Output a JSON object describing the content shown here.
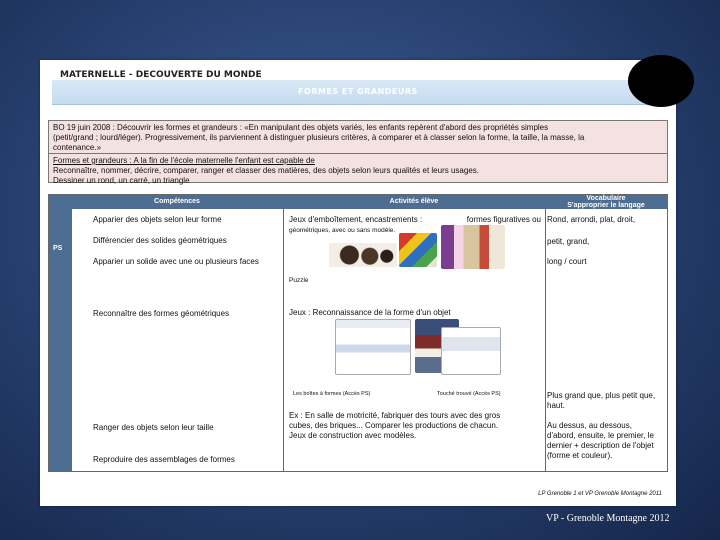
{
  "header": {
    "title": "MATERNELLE - DECOUVERTE DU MONDE",
    "subtitle": "FORMES ET GRANDEURS"
  },
  "box1": {
    "line1": "BO 19 juin 2008 : Découvrir les formes et grandeurs : «En manipulant des objets variés, les enfants repèrent d'abord des propriétés simples",
    "line2": "(petit/grand ; lourd/léger). Progressivement, ils parviennent à distinguer plusieurs critères, à comparer et à classer selon la forme, la taille, la masse, la",
    "line3": "contenance.»"
  },
  "box2": {
    "line1": "Formes et grandeurs : A la fin de l'école maternelle l'enfant est capable de",
    "line2": "Reconnaître, nommer, décrire, comparer, ranger et classer des matières, des objets selon leurs qualités et leurs usages.",
    "line3": "Dessiner un rond, un carré, un triangle"
  },
  "table": {
    "headers": {
      "competences": "Compétences",
      "activites": "Activités élève",
      "vocabulaire_line1": "Vocabulaire",
      "vocabulaire_line2": "S'approprier le langage"
    },
    "row_label": "PS",
    "competences": [
      "Apparier des objets selon leur forme",
      "Différencier des solides géométriques",
      "Apparier un solide avec une ou plusieurs faces",
      "Reconnaître des formes géométriques",
      "Ranger des objets selon leur taille",
      "Reproduire des assemblages de formes"
    ],
    "activites": {
      "a1_left": "Jeux d'emboîtement, encastrements :",
      "a1_right": "formes figuratives ou",
      "a1_line2": "géométriques, avec ou sans modèle.",
      "a2": "Puzzle",
      "a3": "Jeux : Reconnaissance de la forme d'un objet",
      "caption_left": "Les boîtes à formes (Accès PS)",
      "caption_right": "Touché trouvé (Accès PS)",
      "a4_line1": "Ex : En salle de motricité, fabriquer des tours avec des gros",
      "a4_line2": "cubes, des briques... Comparer les productions de chacun.",
      "a5": "Jeux de construction avec modèles."
    },
    "vocabulaire": {
      "v1": "Rond, arrondi, plat, droit,",
      "v2": "petit, grand,",
      "v3": "long / court",
      "v4_line1": "Plus grand que, plus petit que,",
      "v4_line2": "haut.",
      "v5_line1": "Au dessus, au dessous,",
      "v5_line2": "d'abord, ensuite, le premier, le",
      "v5_line3": "dernier + description de l'objet",
      "v5_line4": "(forme et couleur)."
    }
  },
  "credit": "LP Grenoble 1 et VP Grenoble Montagne 2011",
  "footer": "VP - Grenoble Montagne 2012",
  "colors": {
    "background": "#2a4475",
    "header_band": "#4e6d92",
    "pink_box": "#f4e1e1"
  }
}
